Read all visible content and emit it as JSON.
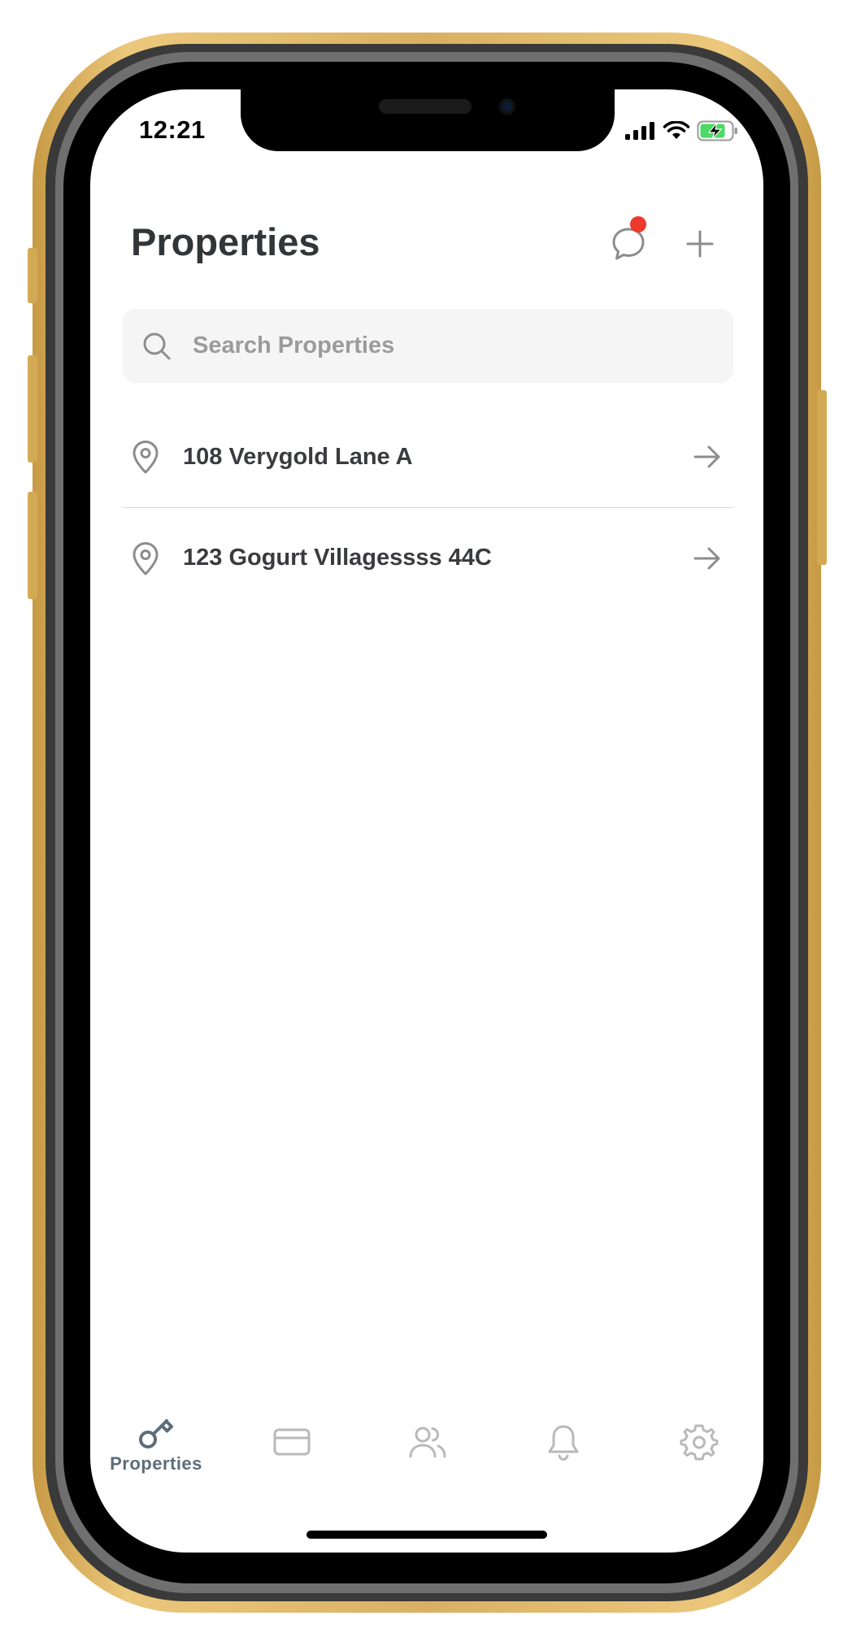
{
  "status_bar": {
    "time": "12:21"
  },
  "header": {
    "title": "Properties",
    "chat_icon": "chat-bubble-icon",
    "add_icon": "plus-icon",
    "notification_dot_color": "#ee3a2c"
  },
  "search": {
    "placeholder": "Search Properties",
    "value": ""
  },
  "properties": [
    {
      "label": "108 Verygold Lane A",
      "icon": "location-pin-icon",
      "action_icon": "arrow-right-icon"
    },
    {
      "label": "123 Gogurt Villagessss 44C",
      "icon": "location-pin-icon",
      "action_icon": "arrow-right-icon"
    }
  ],
  "tabbar": {
    "tabs": [
      {
        "label": "Properties",
        "icon": "key-icon",
        "active": true
      },
      {
        "label": "",
        "icon": "credit-card-icon",
        "active": false
      },
      {
        "label": "",
        "icon": "users-icon",
        "active": false
      },
      {
        "label": "",
        "icon": "bell-icon",
        "active": false
      },
      {
        "label": "",
        "icon": "gear-icon",
        "active": false
      }
    ],
    "active_color": "#5d6d7a",
    "inactive_color": "#b9b9b9"
  },
  "colors": {
    "phone_frame": "#d9b063",
    "title_text": "#333639",
    "search_background": "#f5f5f5"
  }
}
